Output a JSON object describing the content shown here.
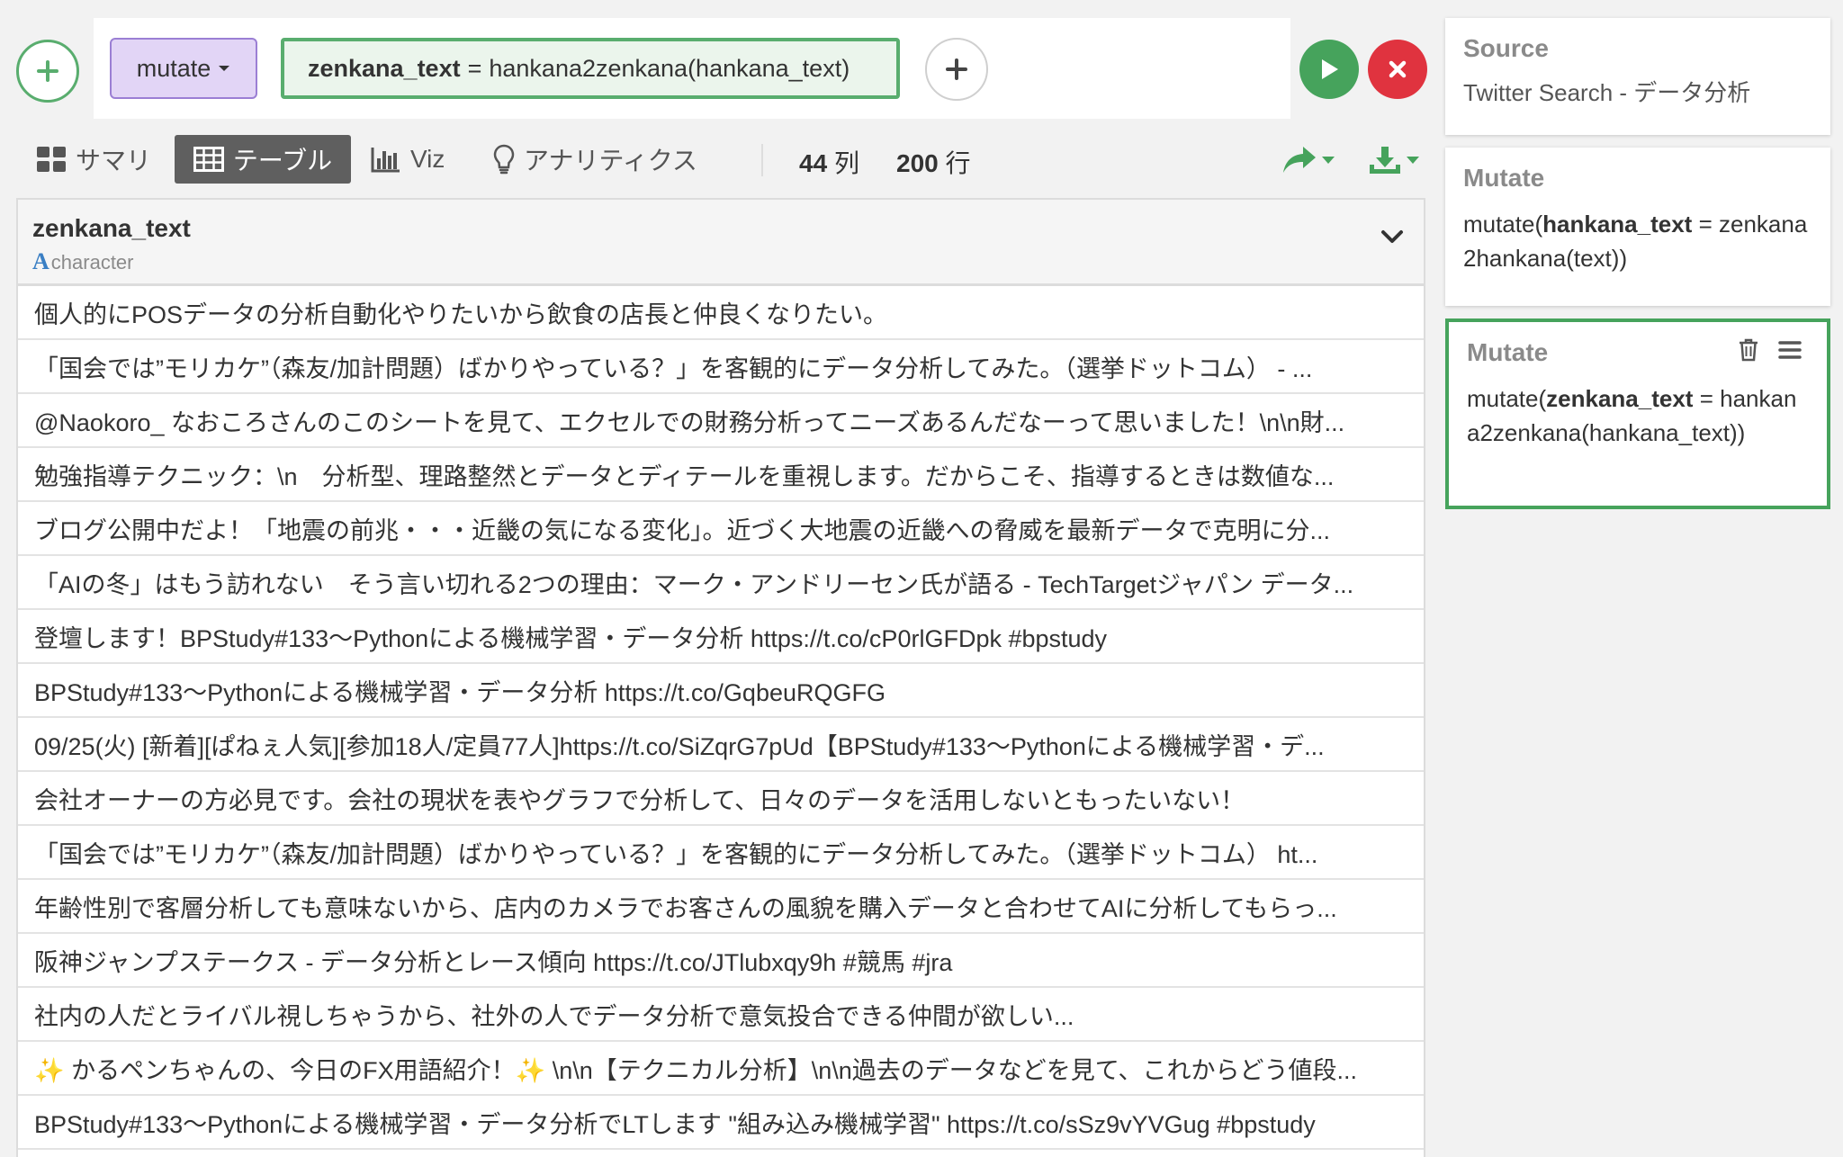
{
  "command": {
    "type_label": "mutate",
    "expr_column": "zenkana_text",
    "expr_operator": "=",
    "expr_value": "hankana2zenkana(hankana_text)"
  },
  "tabs": [
    {
      "label": "サマリ",
      "icon": "grid-icon"
    },
    {
      "label": "テーブル",
      "icon": "table-icon",
      "active": true
    },
    {
      "label": "Viz",
      "icon": "bar-chart-icon"
    },
    {
      "label": "アナリティクス",
      "icon": "lightbulb-icon"
    }
  ],
  "counts": {
    "cols_num": "44",
    "cols_label": "列",
    "rows_num": "200",
    "rows_label": "行"
  },
  "table": {
    "column_name": "zenkana_text",
    "column_type": "character",
    "rows": [
      "個人的にPOSデータの分析自動化やりたいから飲食の店長と仲良くなりたい。",
      "「国会では”モリカケ”（森友/加計問題）ばかりやっている？」を客観的にデータ分析してみた。（選挙ドットコム） - ...",
      "@Naokoro_ なおころさんのこのシートを見て、エクセルでの財務分析ってニーズあるんだなーって思いました！\\n\\n財...",
      "勉強指導テクニック：\\n　分析型、理路整然とデータとディテールを重視します。だからこそ、指導するときは数値な...",
      "ブログ公開中だよ！「地震の前兆・・・近畿の気になる変化」。近づく大地震の近畿への脅威を最新データで克明に分...",
      "「AIの冬」はもう訪れない　そう言い切れる2つの理由：マーク・アンドリーセン氏が語る - TechTargetジャパン データ...",
      "登壇します！BPStudy#133〜Pythonによる機械学習・データ分析 https://t.co/cP0rlGFDpk #bpstudy",
      "BPStudy#133〜Pythonによる機械学習・データ分析 https://t.co/GqbeuRQGFG",
      "09/25(火) [新着][ぱねぇ人気][参加18人/定員77人]https://t.co/SiZqrG7pUd【BPStudy#133〜Pythonによる機械学習・デ...",
      "会社オーナーの方必見です。会社の現状を表やグラフで分析して、日々のデータを活用しないともったいない！",
      "「国会では”モリカケ”（森友/加計問題）ばかりやっている？」を客観的にデータ分析してみた。（選挙ドットコム） ht...",
      "年齢性別で客層分析しても意味ないから、店内のカメラでお客さんの風貌を購入データと合わせてAIに分析してもらっ...",
      "阪神ジャンプステークス - データ分析とレース傾向 https://t.co/JTlubxqy9h #競馬 #jra",
      "社内の人だとライバル視しちゃうから、社外の人でデータ分析で意気投合できる仲間が欲しい...",
      "✨ かるペンちゃんの、今日のFX用語紹介！✨ \\n\\n【テクニカル分析】\\n\\n過去のデータなどを見て、これからどう値段...",
      "BPStudy#133〜Pythonによる機械学習・データ分析でLTします \"組み込み機械学習\" https://t.co/sSz9vYVGug #bpstudy"
    ]
  },
  "steps": {
    "source": {
      "title": "Source",
      "body": "Twitter Search - データ分析"
    },
    "mutate1": {
      "title": "Mutate",
      "func": "mutate(",
      "col": "hankana_text",
      "op": " = ",
      "rest": "zenkana2hankana(text))"
    },
    "mutate2": {
      "title": "Mutate",
      "func": "mutate(",
      "col": "zenkana_text",
      "op": " = ",
      "rest": "hankana2zenkana(hankana_text))"
    }
  },
  "colors": {
    "accent_green": "#46a35c",
    "danger_red": "#e0333f",
    "command_purple": "#e2d5f6"
  }
}
